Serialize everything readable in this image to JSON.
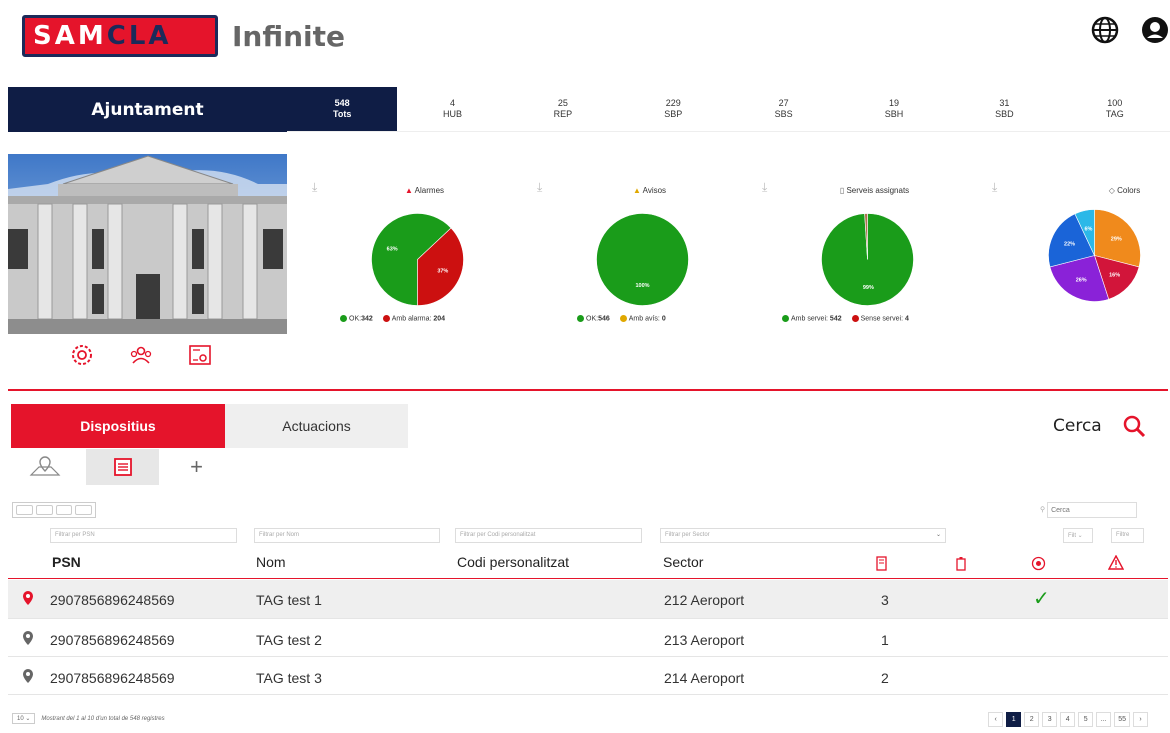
{
  "header": {
    "logo_part1": "SAM",
    "logo_part2": "CLA",
    "product": "Infinite",
    "icons": [
      "globe-icon",
      "user-icon"
    ]
  },
  "topbar": {
    "brand": "Ajuntament",
    "tabs": [
      {
        "count": "548",
        "label": "Tots",
        "active": true
      },
      {
        "count": "4",
        "label": "HUB"
      },
      {
        "count": "25",
        "label": "REP"
      },
      {
        "count": "229",
        "label": "SBP"
      },
      {
        "count": "27",
        "label": "SBS"
      },
      {
        "count": "19",
        "label": "SBH"
      },
      {
        "count": "31",
        "label": "SBD"
      },
      {
        "count": "100",
        "label": "TAG"
      }
    ]
  },
  "charts": [
    {
      "title": "Alarmes",
      "icon": "warning-icon",
      "legend": [
        {
          "label": "OK:",
          "value": "342",
          "color": "#1a9c1a"
        },
        {
          "label": "Amb alarma:",
          "value": "204",
          "color": "#cc1010"
        }
      ],
      "slices": [
        {
          "label": "63%",
          "value": 63,
          "color": "#1a9c1a"
        },
        {
          "label": "37%",
          "value": 37,
          "color": "#cc1010"
        }
      ]
    },
    {
      "title": "Avisos",
      "icon": "warning-icon",
      "legend": [
        {
          "label": "OK:",
          "value": "546",
          "color": "#1a9c1a"
        },
        {
          "label": "Amb avís:",
          "value": "0",
          "color": "#e0a800"
        }
      ],
      "slices": [
        {
          "label": "100%",
          "value": 100,
          "color": "#1a9c1a"
        }
      ]
    },
    {
      "title": "Serveis assignats",
      "icon": "clipboard-icon",
      "legend": [
        {
          "label": "Amb servei:",
          "value": "542",
          "color": "#1a9c1a"
        },
        {
          "label": "Sense servei:",
          "value": "4",
          "color": "#cc1010"
        }
      ],
      "slices": [
        {
          "label": "99%",
          "value": 99,
          "color": "#1a9c1a"
        },
        {
          "label": "",
          "value": 1,
          "color": "#b07050"
        }
      ]
    },
    {
      "title": "Colors",
      "icon": "tag-icon",
      "legend": [],
      "slices": [
        {
          "label": "29%",
          "value": 29,
          "color": "#f08a1c"
        },
        {
          "label": "16%",
          "value": 16,
          "color": "#d2153a"
        },
        {
          "label": "26%",
          "value": 26,
          "color": "#8a22d8"
        },
        {
          "label": "22%",
          "value": 22,
          "color": "#1a64d8"
        },
        {
          "label": "6%",
          "value": 7,
          "color": "#2bb8e8"
        }
      ]
    }
  ],
  "sections": {
    "active": "Dispositius",
    "inactive": "Actuacions"
  },
  "search_label": "Cerca",
  "mini_search_placeholder": "Cerca",
  "filters": {
    "psn": "Filtrar per PSN",
    "nom": "Filtrar per Nom",
    "codi": "Filtrar per Codi personalitzat",
    "sector": "Filtrar per Sector",
    "filt": "Filt",
    "filtre": "Filtre"
  },
  "columns": {
    "psn": "PSN",
    "nom": "Nom",
    "codi": "Codi personalitzat",
    "sector": "Sector"
  },
  "rows": [
    {
      "psn": "2907856896248569",
      "nom": "TAG test 1",
      "codi": "",
      "sector": "212 Aeroport",
      "count": "3",
      "check": "✓"
    },
    {
      "psn": "2907856896248569",
      "nom": "TAG test 2",
      "codi": "",
      "sector": "213 Aeroport",
      "count": "1",
      "check": ""
    },
    {
      "psn": "2907856896248569",
      "nom": "TAG test 3",
      "codi": "",
      "sector": "214 Aeroport",
      "count": "2",
      "check": ""
    }
  ],
  "footer": {
    "page_size": "10",
    "info": "Mostrant del 1 al 10 d'un total de 548 registres",
    "pages": [
      "‹",
      "1",
      "2",
      "3",
      "4",
      "5",
      "...",
      "55",
      "›"
    ],
    "current_page": "1"
  }
}
